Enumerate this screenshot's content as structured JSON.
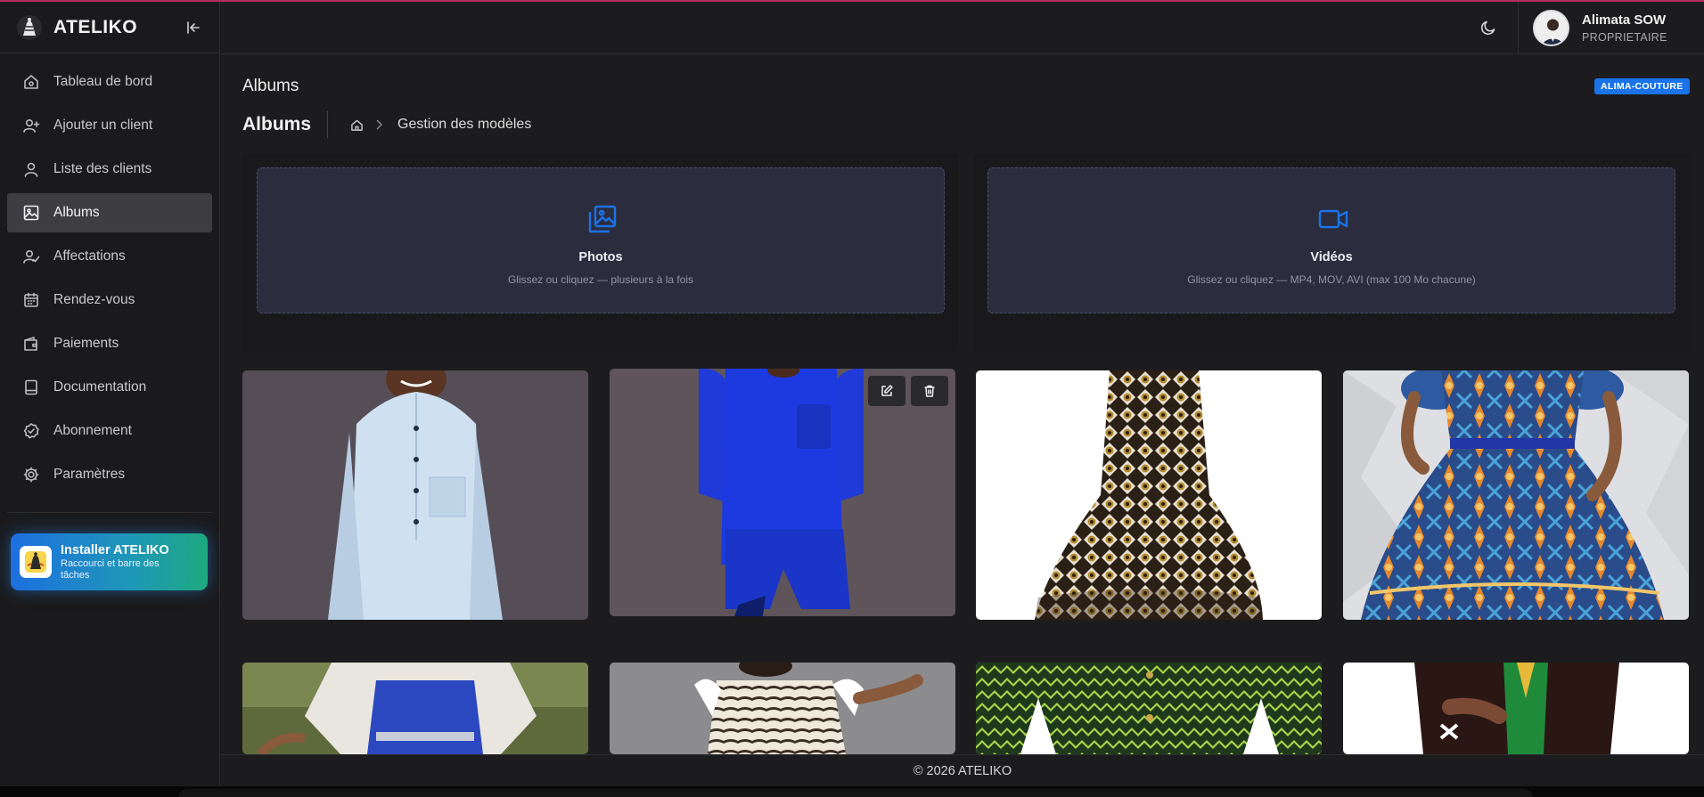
{
  "app": {
    "name": "ATELIKO",
    "accent": "#1a73e8"
  },
  "sidebar": {
    "items": [
      {
        "label": "Tableau de bord",
        "icon": "home-icon"
      },
      {
        "label": "Ajouter un client",
        "icon": "user-plus-icon"
      },
      {
        "label": "Liste des clients",
        "icon": "user-icon"
      },
      {
        "label": "Albums",
        "icon": "image-icon",
        "active": true
      },
      {
        "label": "Affectations",
        "icon": "user-check-icon"
      },
      {
        "label": "Rendez-vous",
        "icon": "calendar-icon"
      },
      {
        "label": "Paiements",
        "icon": "wallet-icon"
      },
      {
        "label": "Documentation",
        "icon": "book-icon"
      },
      {
        "label": "Abonnement",
        "icon": "badge-check-icon"
      },
      {
        "label": "Paramètres",
        "icon": "gear-icon"
      }
    ],
    "install": {
      "title": "Installer ATELIKO",
      "subtitle": "Raccourci et barre des tâches"
    }
  },
  "topbar": {
    "user_name": "Alimata SOW",
    "user_role": "PROPRIETAIRE"
  },
  "main": {
    "page_title": "Albums",
    "tenant_badge": "ALIMA-COUTURE",
    "section_title": "Albums",
    "breadcrumb_current": "Gestion des modèles",
    "upload": {
      "photos_title": "Photos",
      "photos_hint": "Glissez ou cliquez — plusieurs à la fois",
      "videos_title": "Vidéos",
      "videos_hint": "Glissez ou cliquez — MP4, MOV, AVI (max 100 Mo chacune)"
    }
  },
  "footer": {
    "text": "© 2026 ATELIKO"
  }
}
